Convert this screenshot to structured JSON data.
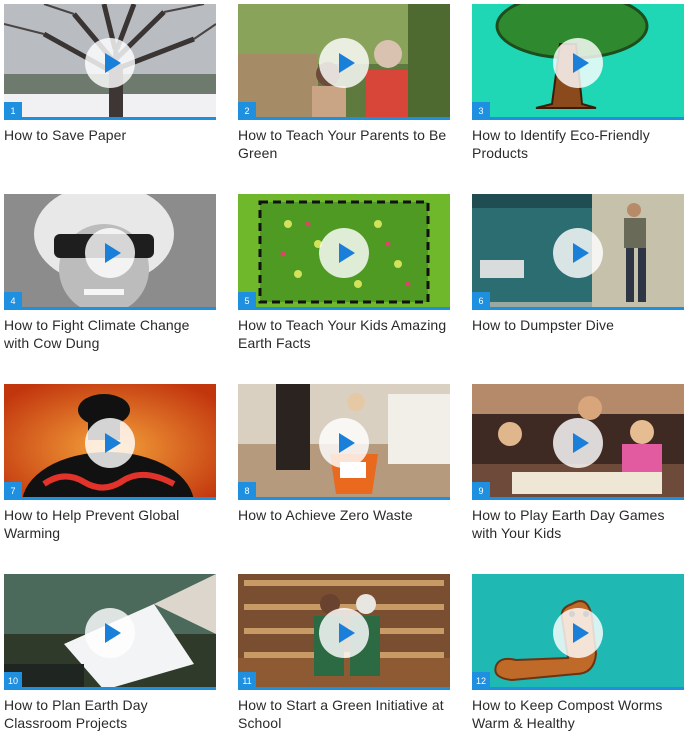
{
  "videos": [
    {
      "number": "1",
      "title": "How to Save Paper"
    },
    {
      "number": "2",
      "title": "How to Teach Your Parents to Be Green"
    },
    {
      "number": "3",
      "title": "How to Identify Eco-Friendly Products"
    },
    {
      "number": "4",
      "title": "How to Fight Climate Change with Cow Dung"
    },
    {
      "number": "5",
      "title": "How to Teach Your Kids Amazing Earth Facts"
    },
    {
      "number": "6",
      "title": "How to Dumpster Dive"
    },
    {
      "number": "7",
      "title": "How to Help Prevent Global Warming"
    },
    {
      "number": "8",
      "title": "How to Achieve Zero Waste"
    },
    {
      "number": "9",
      "title": "How to Play Earth Day Games with Your Kids"
    },
    {
      "number": "10",
      "title": "How to Plan Earth Day Classroom Projects"
    },
    {
      "number": "11",
      "title": "How to Start a Green Initiative at School"
    },
    {
      "number": "12",
      "title": "How to Keep Compost Worms Warm & Healthy"
    }
  ],
  "colors": {
    "accent": "#1f8fe0",
    "play_icon": "#1a7fd9",
    "title_text": "#2a2a2a"
  },
  "icons": {
    "play": "play-icon"
  }
}
